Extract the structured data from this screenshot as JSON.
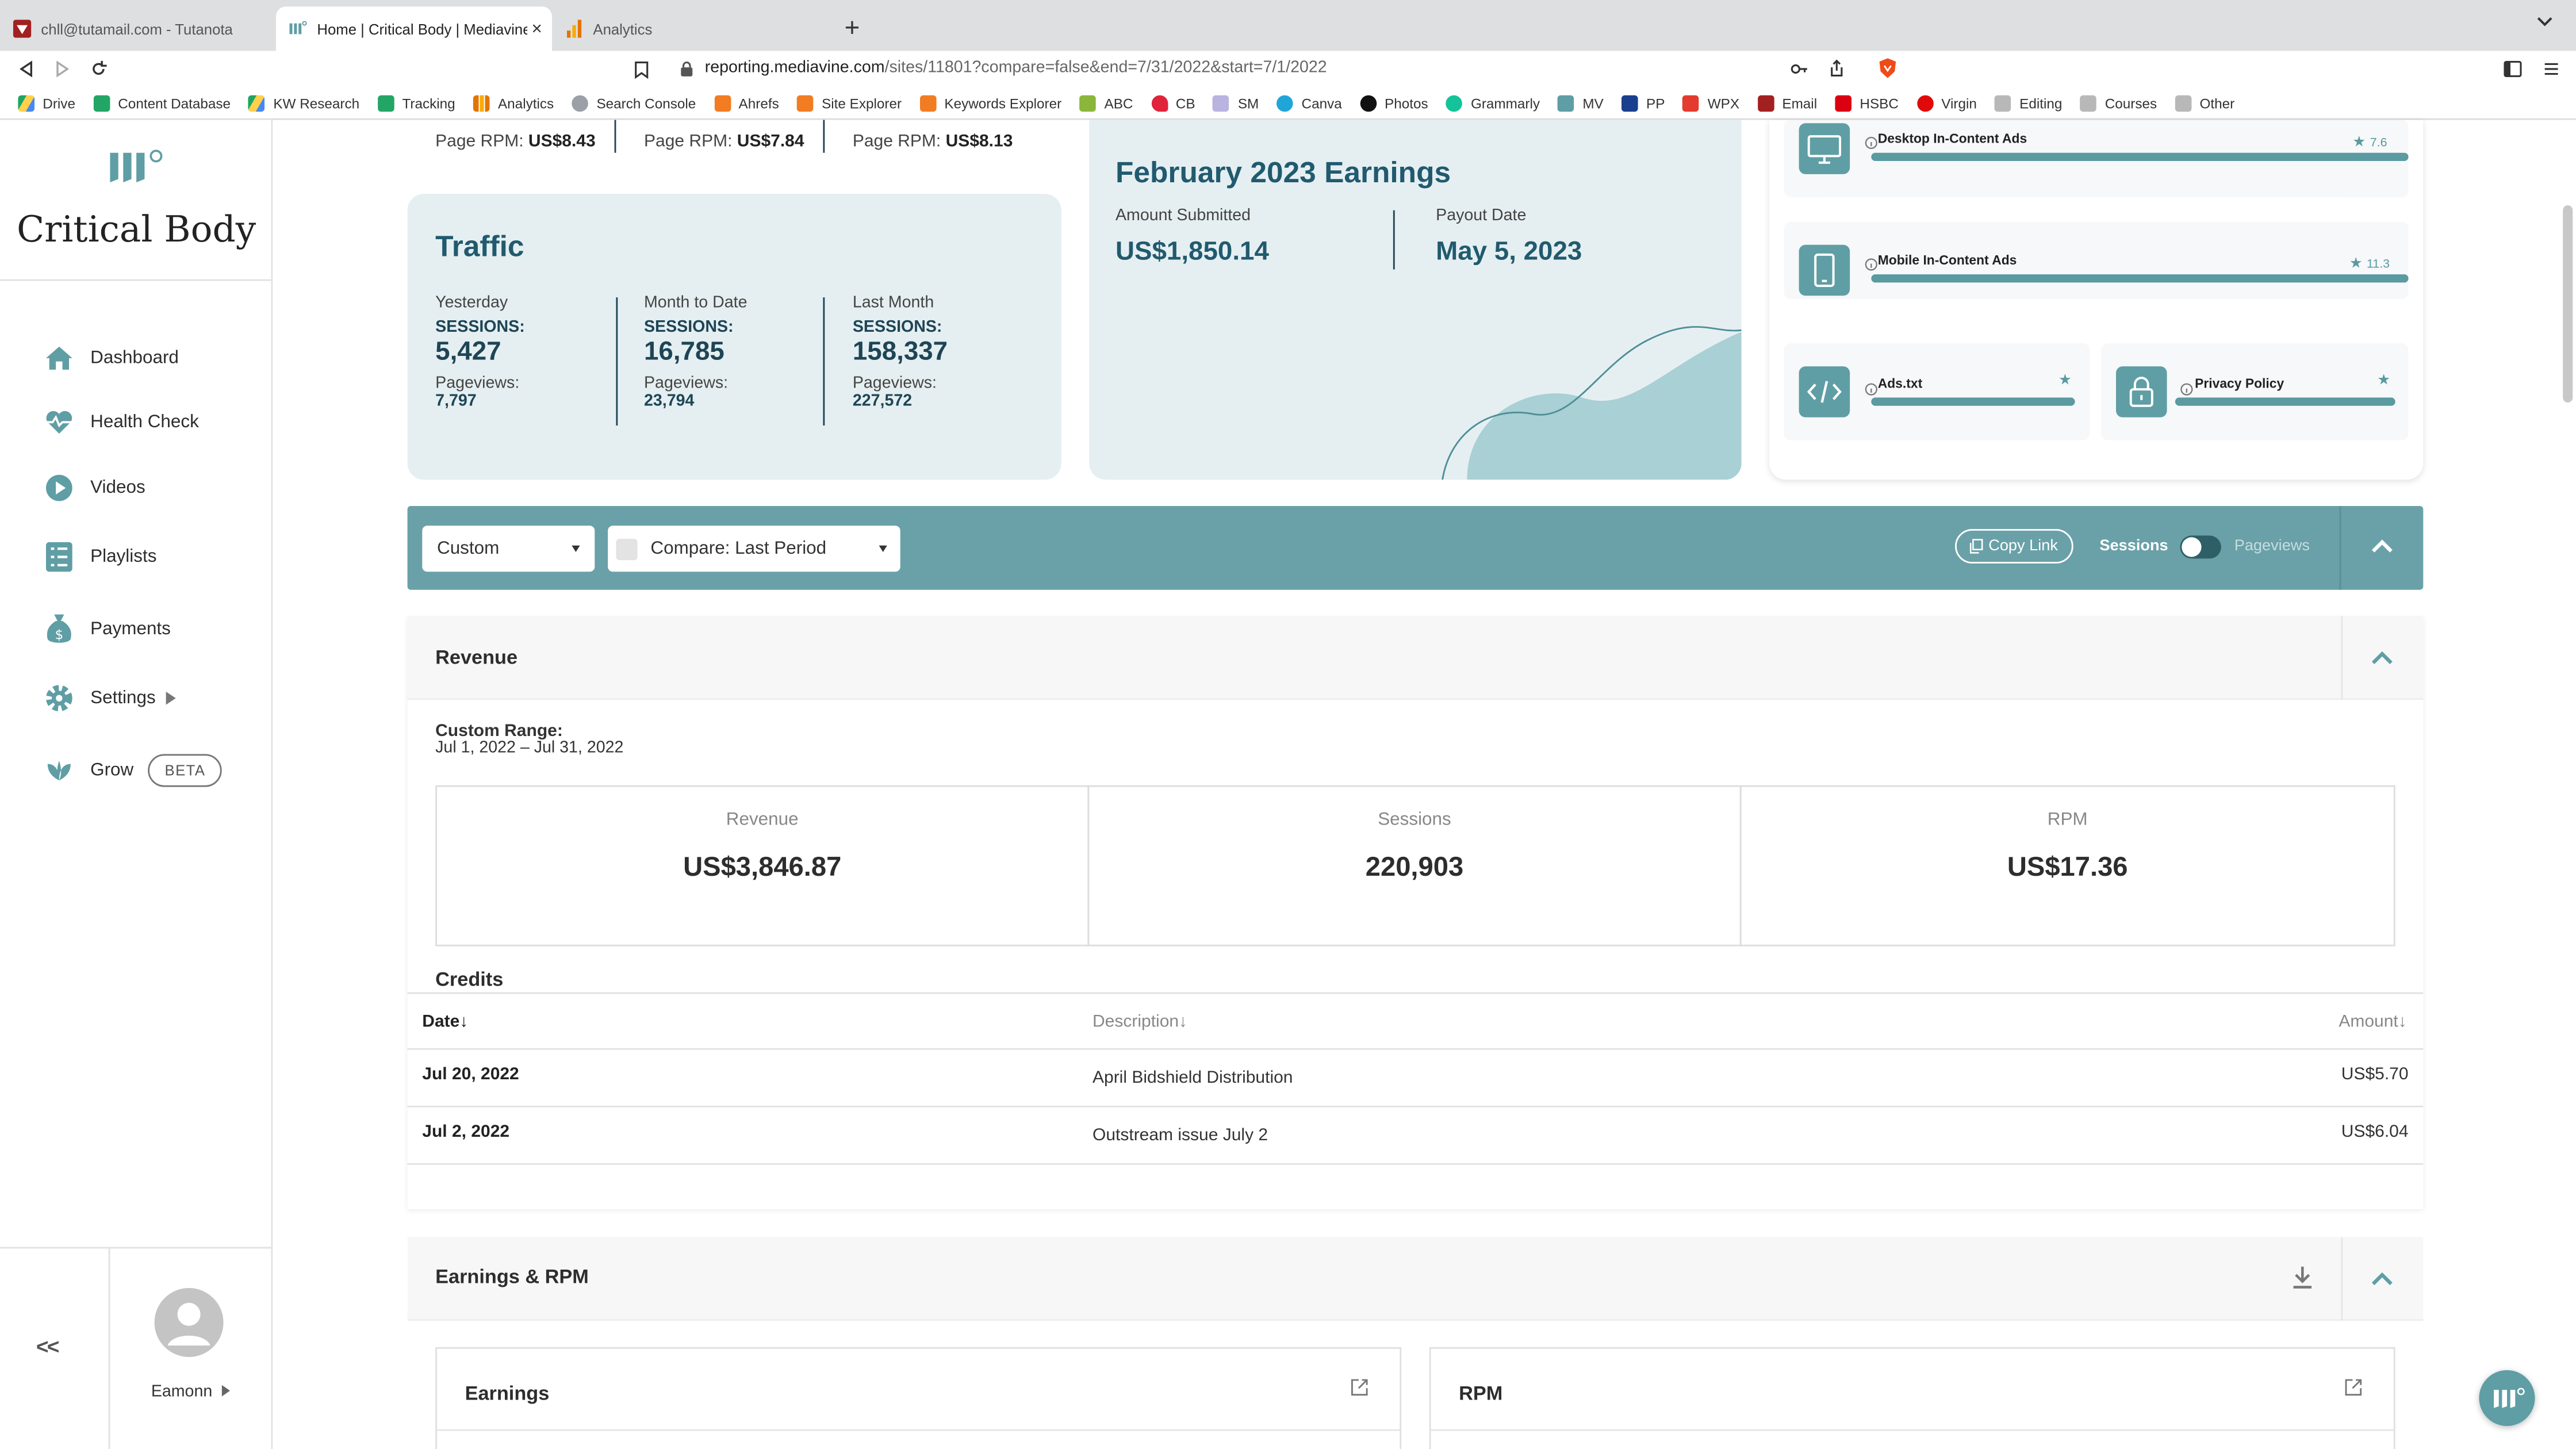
{
  "browser": {
    "tabs": [
      {
        "label": "chll@tutamail.com - Tutanota",
        "active": false
      },
      {
        "label": "Home | Critical Body | Mediavine",
        "active": true
      },
      {
        "label": "Analytics",
        "active": false
      }
    ],
    "url_host": "reporting.mediavine.com",
    "url_path": "/sites/11801?compare=false&end=7/31/2022&start=7/1/2022",
    "bookmarks": [
      "Drive",
      "Content Database",
      "KW Research",
      "Tracking",
      "Analytics",
      "Search Console",
      "Ahrefs",
      "Site Explorer",
      "Keywords Explorer",
      "ABC",
      "CB",
      "SM",
      "Canva",
      "Photos",
      "Grammarly",
      "MV",
      "PP",
      "WPX",
      "Email",
      "HSBC",
      "Virgin",
      "Editing",
      "Courses",
      "Other"
    ]
  },
  "sidebar": {
    "site_name": "Critical Body",
    "items": [
      {
        "label": "Dashboard"
      },
      {
        "label": "Health Check"
      },
      {
        "label": "Videos"
      },
      {
        "label": "Playlists"
      },
      {
        "label": "Payments"
      },
      {
        "label": "Settings"
      },
      {
        "label": "Grow",
        "badge": "BETA"
      }
    ],
    "collapse_label": "<<",
    "user_name": "Eamonn"
  },
  "rpm_row": [
    {
      "label": "Page RPM:",
      "value": "US$8.43"
    },
    {
      "label": "Page RPM:",
      "value": "US$7.84"
    },
    {
      "label": "Page RPM:",
      "value": "US$8.13"
    }
  ],
  "traffic": {
    "title": "Traffic",
    "columns": [
      {
        "period": "Yesterday",
        "sessions_label": "SESSIONS:",
        "sessions": "5,427",
        "pageviews_label": "Pageviews:",
        "pageviews": "7,797"
      },
      {
        "period": "Month to Date",
        "sessions_label": "SESSIONS:",
        "sessions": "16,785",
        "pageviews_label": "Pageviews:",
        "pageviews": "23,794"
      },
      {
        "period": "Last Month",
        "sessions_label": "SESSIONS:",
        "sessions": "158,337",
        "pageviews_label": "Pageviews:",
        "pageviews": "227,572"
      }
    ]
  },
  "earnings_card": {
    "title": "February 2023 Earnings",
    "amount_label": "Amount Submitted",
    "amount": "US$1,850.14",
    "payout_label": "Payout Date",
    "payout": "May 5, 2023"
  },
  "ads": {
    "desktop": {
      "label": "Desktop In-Content Ads",
      "score": "7.6"
    },
    "mobile": {
      "label": "Mobile In-Content Ads",
      "score": "11.3"
    },
    "adstxt": {
      "label": "Ads.txt"
    },
    "privacy": {
      "label": "Privacy Policy"
    }
  },
  "controls": {
    "range": "Custom",
    "compare": "Compare: Last Period",
    "copy_link": "Copy Link",
    "sessions": "Sessions",
    "pageviews": "Pageviews"
  },
  "revenue": {
    "title": "Revenue",
    "range_label": "Custom Range:",
    "range_value": "Jul 1, 2022 – Jul 31, 2022",
    "kpis": [
      {
        "label": "Revenue",
        "value": "US$3,846.87"
      },
      {
        "label": "Sessions",
        "value": "220,903"
      },
      {
        "label": "RPM",
        "value": "US$17.36"
      }
    ]
  },
  "credits": {
    "title": "Credits",
    "headers": {
      "date": "Date↓",
      "description": "Description↓",
      "amount": "Amount↓"
    },
    "rows": [
      {
        "date": "Jul 20, 2022",
        "description": "April Bidshield Distribution",
        "amount": "US$5.70"
      },
      {
        "date": "Jul 2, 2022",
        "description": "Outstream issue July 2",
        "amount": "US$6.04"
      }
    ]
  },
  "earnings_rpm": {
    "title": "Earnings & RPM",
    "earnings": "Earnings",
    "rpm": "RPM"
  },
  "colors": {
    "accent": "#6aa1a8",
    "dark_teal": "#215a6f",
    "card_bg": "#e5eff1"
  }
}
